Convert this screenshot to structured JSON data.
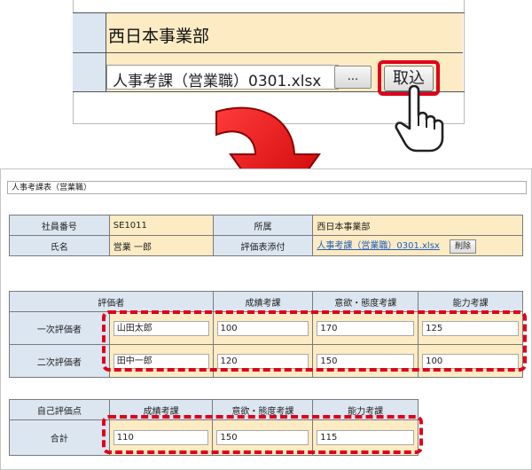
{
  "zoom": {
    "department": "西日本事業部",
    "file_name": "人事考課（営業職）0301.xlsx",
    "browse_label": "...",
    "import_label": "取込"
  },
  "form": {
    "title": "人事考課表（営業職）",
    "info": {
      "employee_no_label": "社員番号",
      "employee_no": "SE1011",
      "dept_label": "所属",
      "dept": "西日本事業部",
      "name_label": "氏名",
      "name": "営業 一郎",
      "attach_label": "評価表添付",
      "attach_file": "人事考課（営業職）0301.xlsx",
      "delete_label": "削除"
    },
    "evaluators": {
      "headers": [
        "評価者",
        "成績考課",
        "意欲・態度考課",
        "能力考課"
      ],
      "rows": [
        {
          "label": "一次評価者",
          "name": "山田太郎",
          "performance": "100",
          "attitude": "170",
          "ability": "125"
        },
        {
          "label": "二次評価者",
          "name": "田中一郎",
          "performance": "120",
          "attitude": "150",
          "ability": "100"
        }
      ]
    },
    "self_eval": {
      "headers": [
        "自己評価点",
        "成績考課",
        "意欲・態度考課",
        "能力考課"
      ],
      "total_label": "合計",
      "performance": "110",
      "attitude": "150",
      "ability": "115"
    }
  },
  "colors": {
    "highlight": "#e0001b",
    "header_bg": "#dce6f1",
    "value_bg": "#fdebc4"
  }
}
